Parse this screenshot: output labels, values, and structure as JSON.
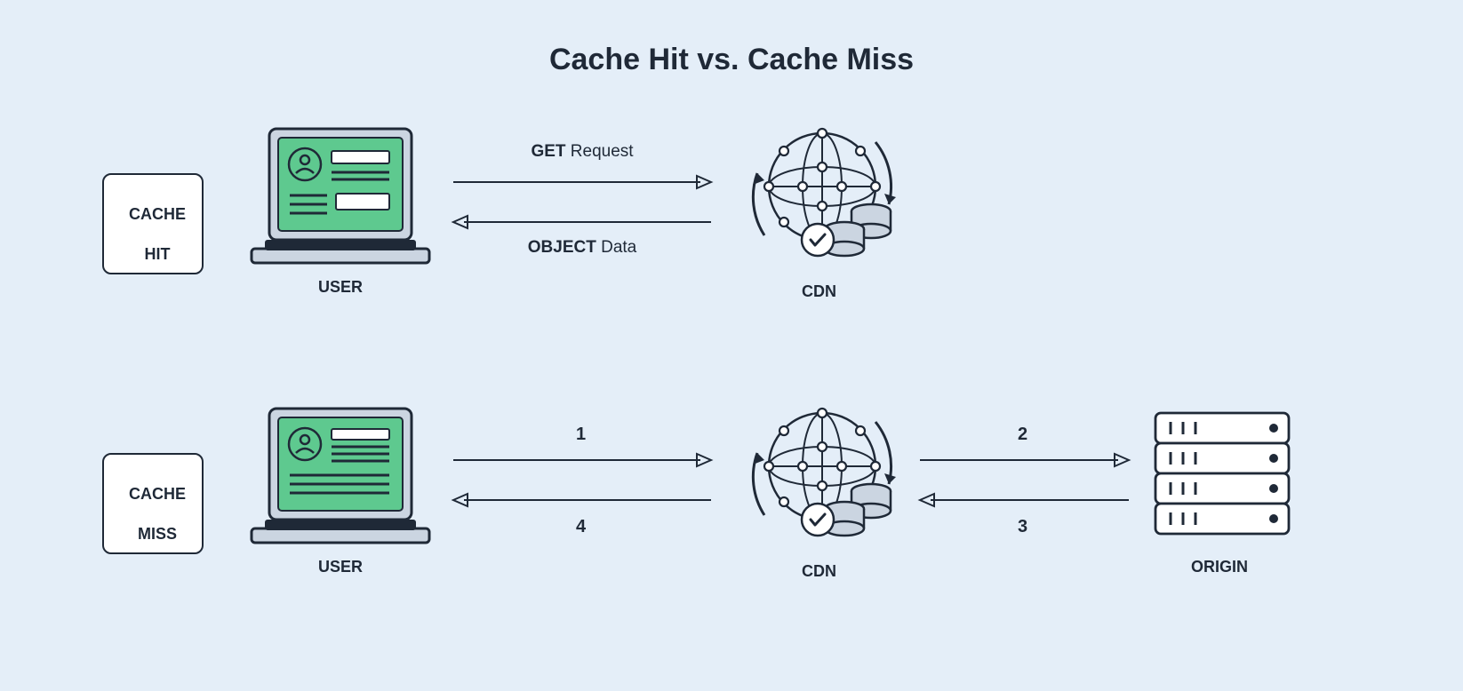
{
  "title": "Cache Hit vs. Cache Miss",
  "colors": {
    "background": "#e4eef8",
    "stroke": "#1f2937",
    "accent_green": "#5ec98f",
    "accent_light": "#cbd5e1",
    "white": "#ffffff"
  },
  "rows": {
    "hit": {
      "badge_line1": "CACHE",
      "badge_line2": "HIT",
      "user_label": "USER",
      "cdn_label": "CDN",
      "arrow_top": {
        "bold": "GET",
        "rest": " Request"
      },
      "arrow_bottom": {
        "bold": "OBJECT",
        "rest": " Data"
      }
    },
    "miss": {
      "badge_line1": "CACHE",
      "badge_line2": "MISS",
      "user_label": "USER",
      "cdn_label": "CDN",
      "origin_label": "ORIGIN",
      "steps": {
        "one": "1",
        "two": "2",
        "three": "3",
        "four": "4"
      }
    }
  }
}
